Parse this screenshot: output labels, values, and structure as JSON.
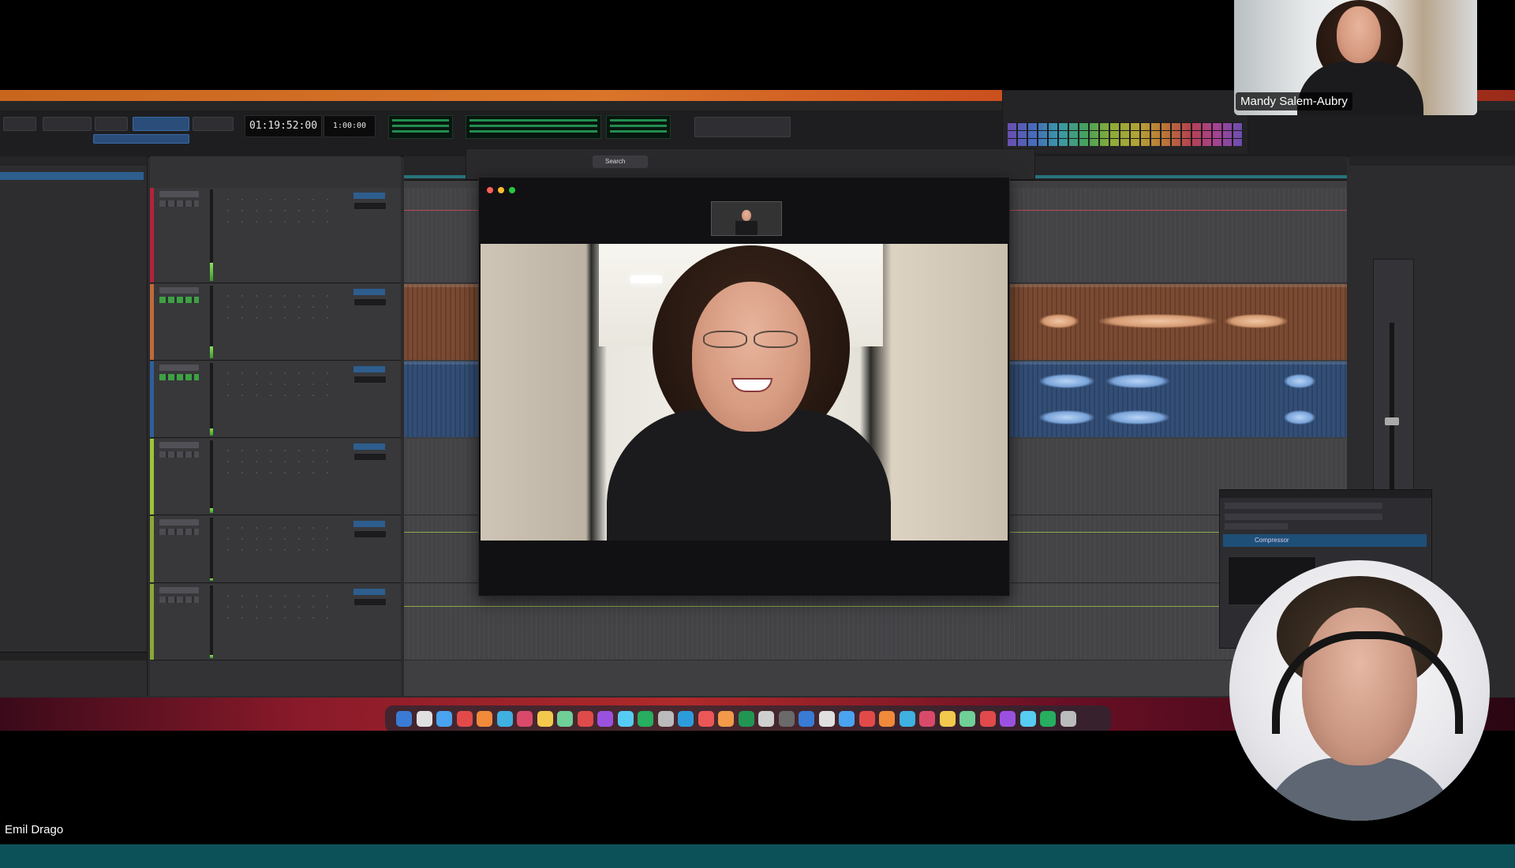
{
  "meeting": {
    "participants": [
      {
        "name": "Mandy Salem-Aubry",
        "role": "thumbnail"
      },
      {
        "name": "Emil Drago",
        "role": "presenter"
      }
    ]
  },
  "shared_screen": {
    "daw": {
      "toolbar": {
        "counter_main": "01:19:52:00",
        "counter_sub": "1:00:00"
      },
      "plugin": {
        "title": "Compressor"
      }
    },
    "zoom_window": {
      "search_label": "Search"
    }
  },
  "colors": {
    "bottom_bar": "#0d5158",
    "menubar": "#d9742a",
    "clip_orange": "#7a4a32",
    "clip_blue": "#334e76"
  }
}
